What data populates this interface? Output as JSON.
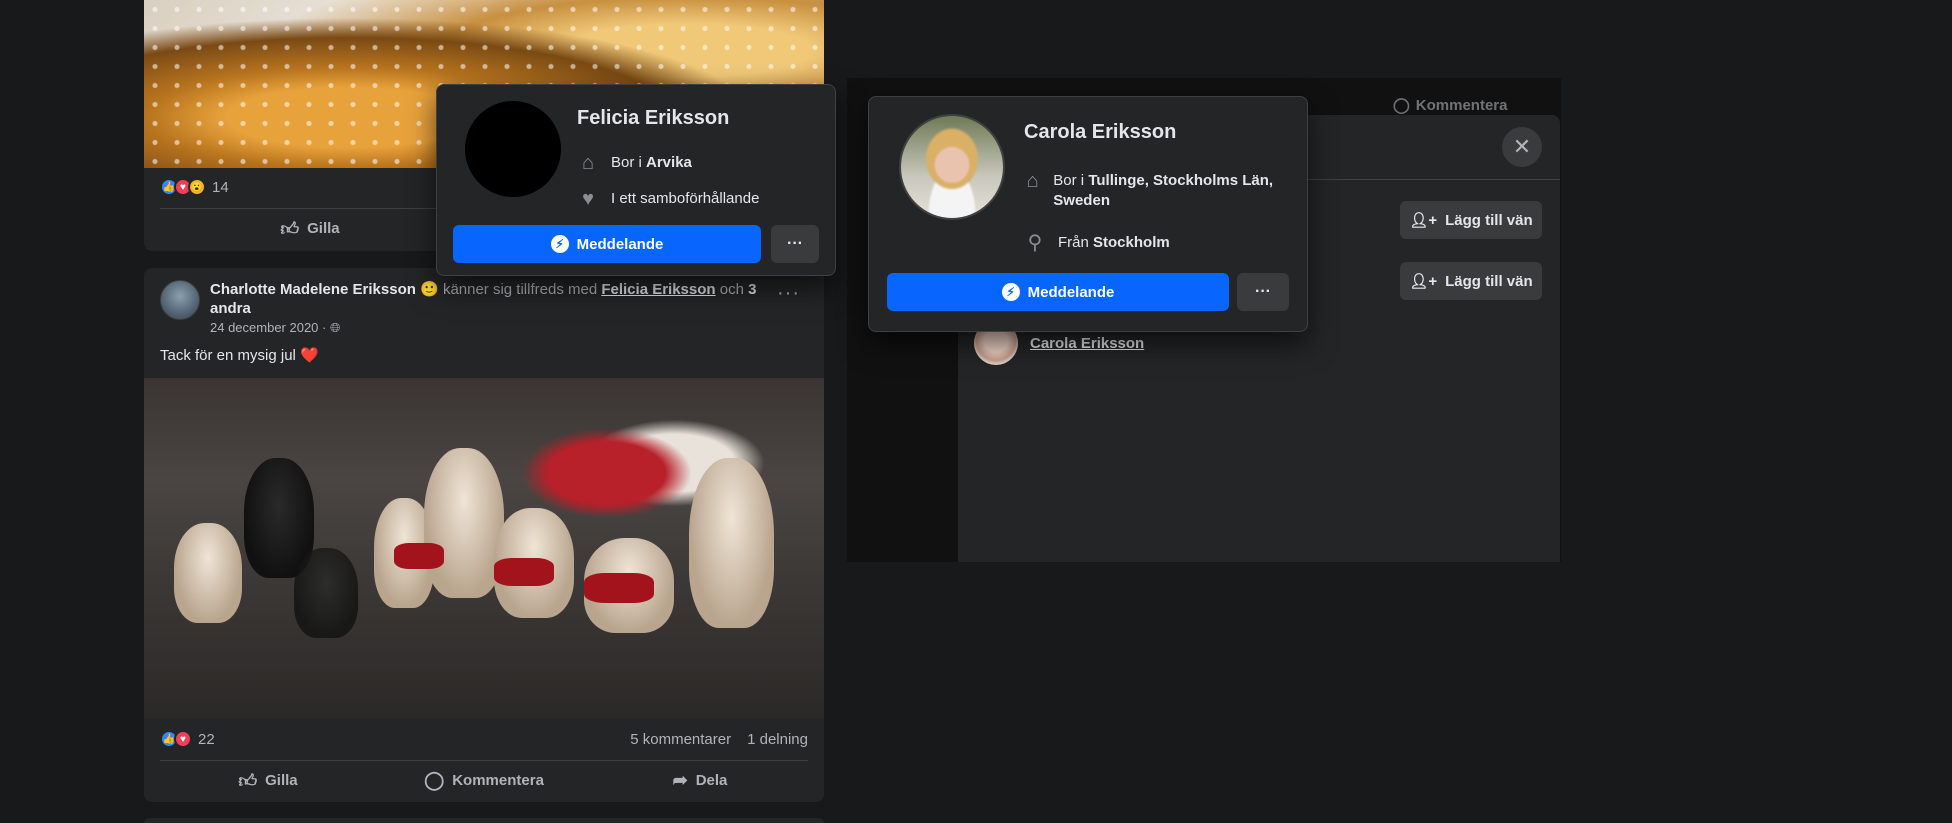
{
  "post_top": {
    "reaction_count": "14",
    "actions": {
      "like": "Gilla"
    }
  },
  "post_main": {
    "author": "Charlotte Madelene Eriksson",
    "feeling_emoji": "🙂",
    "feeling_text": "känner sig tillfreds med",
    "tagged": "Felicia Eriksson",
    "and_text": "och",
    "others": "3 andra",
    "trailing": ".",
    "date": "24 december 2020 ·",
    "privacy_icon": "globe-icon",
    "text": "Tack för en mysig jul",
    "text_emoji": "❤️",
    "reaction_count": "22",
    "comments": "5 kommentarer",
    "shares": "1 delning",
    "actions": {
      "like": "Gilla",
      "comment": "Kommentera",
      "share": "Dela"
    }
  },
  "comment_hint": "Kommentera",
  "dialog": {
    "add_friend_label": "Lägg till vän",
    "list_person": "Carola Eriksson"
  },
  "card_felicia": {
    "name": "Felicia Eriksson",
    "lives_prefix": "Bor i",
    "lives_place": "Arvika",
    "relationship": "I ett samboförhållande",
    "message": "Meddelande",
    "more": "···"
  },
  "card_carola": {
    "name": "Carola Eriksson",
    "lives_prefix": "Bor i",
    "lives_place": "Tullinge, Stockholms Län, Sweden",
    "from_prefix": "Från",
    "from_place": "Stockholm",
    "message": "Meddelande",
    "more": "···"
  },
  "colors": {
    "messenger_blue": "#0866ff",
    "surface": "#242526",
    "background": "#18191a"
  }
}
